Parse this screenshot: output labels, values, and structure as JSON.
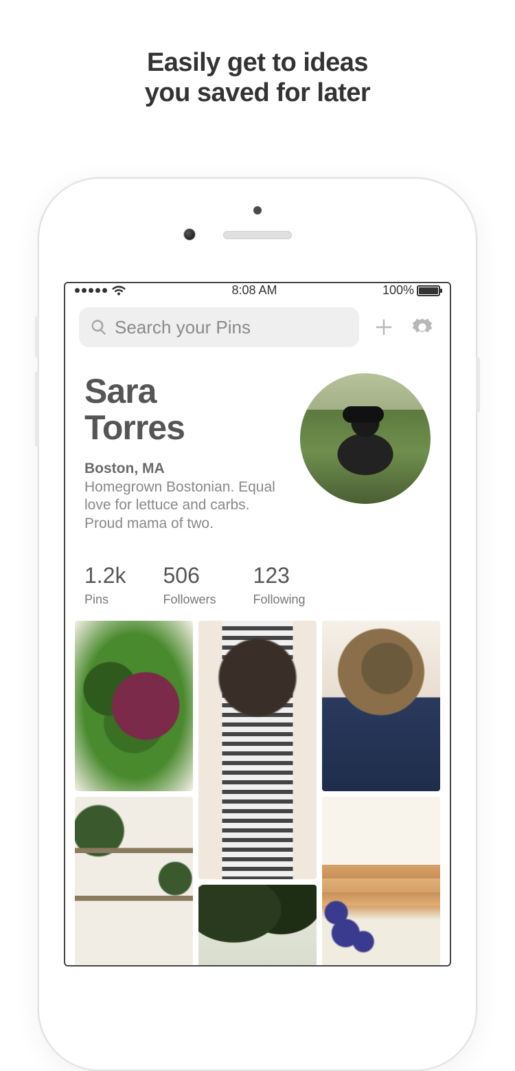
{
  "promo": {
    "line1": "Easily get to ideas",
    "line2": "you saved for later"
  },
  "status": {
    "time": "8:08 AM",
    "battery_pct": "100%"
  },
  "search": {
    "placeholder": "Search your Pins"
  },
  "profile": {
    "name_first": "Sara",
    "name_last": "Torres",
    "location": "Boston, MA",
    "bio": "Homegrown Bostonian. Equal love for lettuce and carbs. Proud mama of two."
  },
  "stats": {
    "pins_count": "1.2k",
    "pins_label": "Pins",
    "followers_count": "506",
    "followers_label": "Followers",
    "following_count": "123",
    "following_label": "Following"
  }
}
